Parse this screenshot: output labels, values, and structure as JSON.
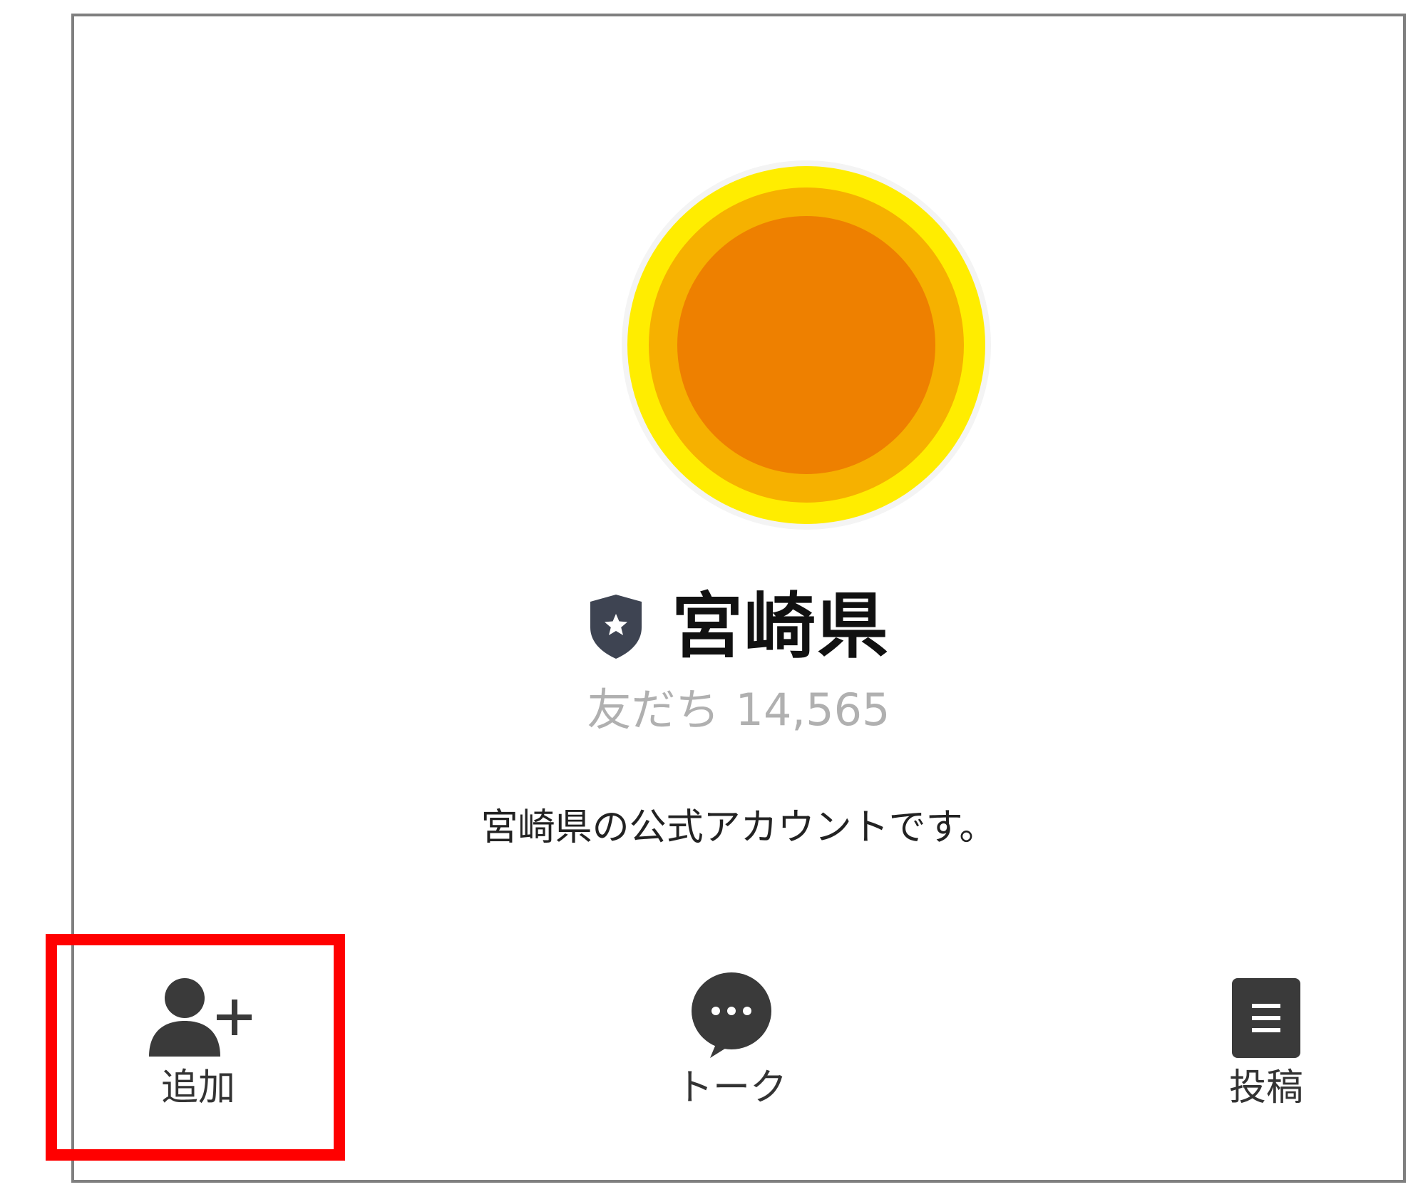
{
  "profile": {
    "name": "宮崎県",
    "friends_label": "友だち",
    "friends_count": "14,565",
    "description": "宮崎県の公式アカウントです。",
    "avatar_colors": {
      "outer": "#ffed00",
      "middle": "#f6b100",
      "inner": "#ee8000"
    },
    "verified_badge_icon": "shield-star-icon",
    "badge_color": "#3e4452"
  },
  "actions": {
    "add": {
      "label": "追加",
      "icon": "add-friend-icon"
    },
    "talk": {
      "label": "トーク",
      "icon": "chat-bubble-icon"
    },
    "post": {
      "label": "投稿",
      "icon": "document-icon"
    }
  },
  "highlight": {
    "color": "#ff0000",
    "target": "add"
  },
  "colors": {
    "icon": "#3a3a3a",
    "frame_border": "#7f7f7f"
  }
}
